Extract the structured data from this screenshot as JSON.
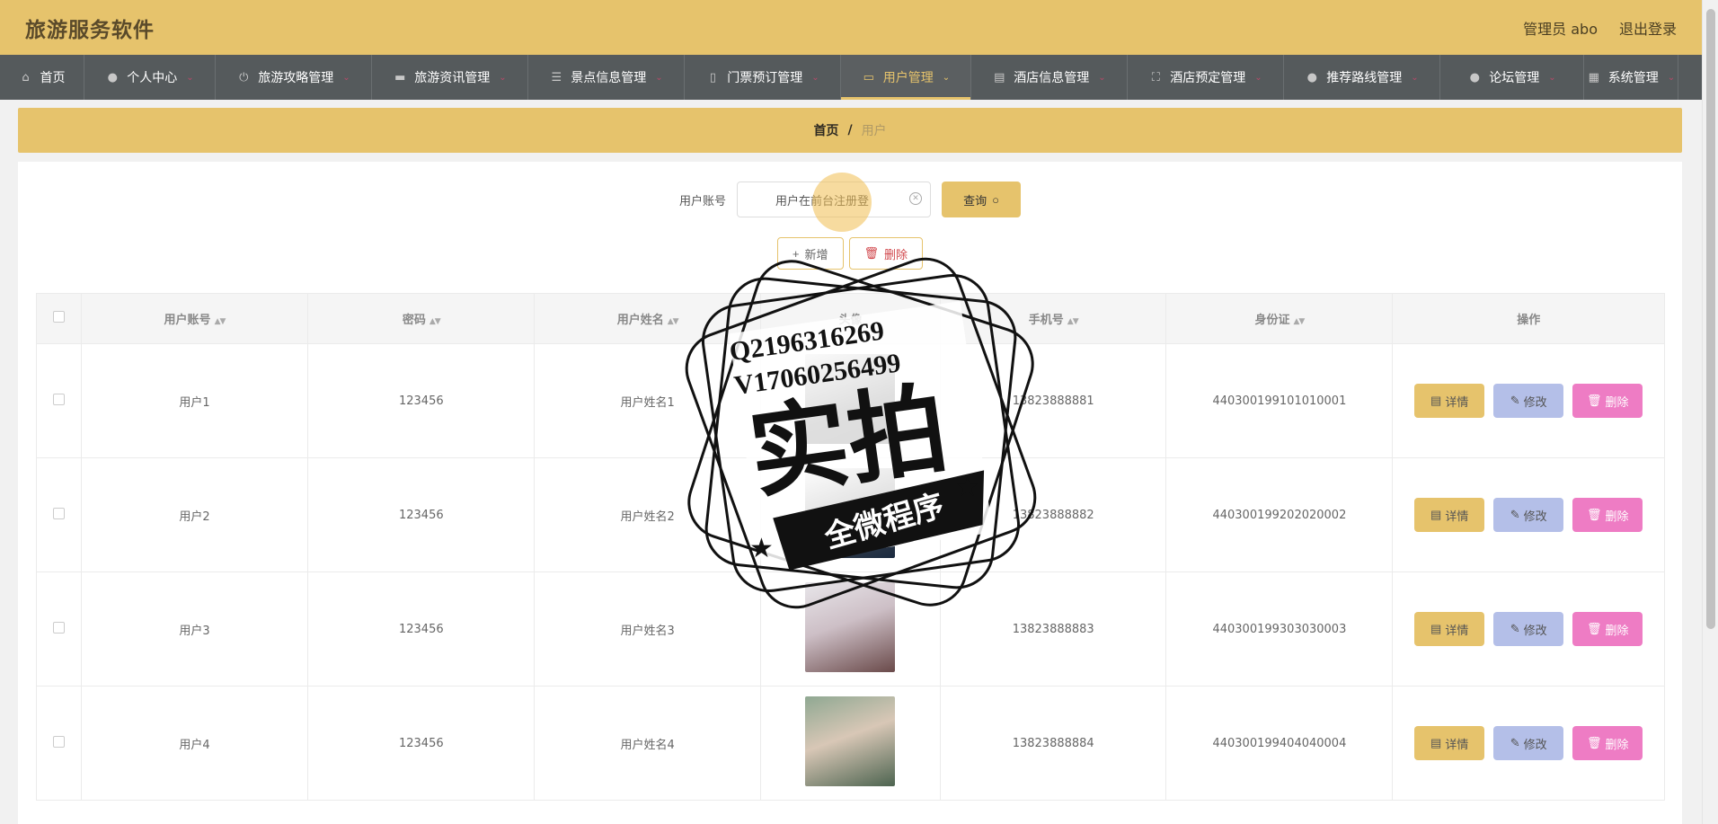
{
  "header": {
    "title": "旅游服务软件",
    "user_label": "管理员 abo",
    "logout_label": "退出登录"
  },
  "nav": {
    "items": [
      {
        "label": "首页",
        "icon": "home-icon",
        "caret": false
      },
      {
        "label": "个人中心",
        "icon": "user-icon",
        "caret": true
      },
      {
        "label": "旅游攻略管理",
        "icon": "power-icon",
        "caret": true
      },
      {
        "label": "旅游资讯管理",
        "icon": "monitor-icon",
        "caret": true
      },
      {
        "label": "景点信息管理",
        "icon": "list-icon",
        "caret": true
      },
      {
        "label": "门票预订管理",
        "icon": "phone-icon",
        "caret": true
      },
      {
        "label": "用户管理",
        "icon": "chat-icon",
        "caret": true,
        "active": true
      },
      {
        "label": "酒店信息管理",
        "icon": "briefcase-icon",
        "caret": true
      },
      {
        "label": "酒店预定管理",
        "icon": "fullscreen-icon",
        "caret": true
      },
      {
        "label": "推荐路线管理",
        "icon": "person-icon",
        "caret": true
      },
      {
        "label": "论坛管理",
        "icon": "person-icon",
        "caret": true
      },
      {
        "label": "系统管理",
        "icon": "grid-icon",
        "caret": true
      }
    ]
  },
  "breadcrumb": {
    "home": "首页",
    "separator": "/",
    "current": "用户"
  },
  "search": {
    "label": "用户账号",
    "value": "用户在前台注册登",
    "query_button": "查询"
  },
  "actions": {
    "add": "新增",
    "delete": "删除"
  },
  "table": {
    "columns": [
      "用户账号",
      "密码",
      "用户姓名",
      "头像",
      "手机号",
      "身份证",
      "操作"
    ],
    "rows": [
      {
        "account": "用户1",
        "password": "123456",
        "name": "用户姓名1",
        "phone": "13823888881",
        "id_card": "440300199101010001"
      },
      {
        "account": "用户2",
        "password": "123456",
        "name": "用户姓名2",
        "phone": "13823888882",
        "id_card": "440300199202020002"
      },
      {
        "account": "用户3",
        "password": "123456",
        "name": "用户姓名3",
        "phone": "13823888883",
        "id_card": "440300199303030003"
      },
      {
        "account": "用户4",
        "password": "123456",
        "name": "用户姓名4",
        "phone": "13823888884",
        "id_card": "440300199404040004"
      }
    ],
    "row_actions": {
      "detail": "详情",
      "edit": "修改",
      "delete": "删除"
    }
  },
  "watermark": {
    "line1": "Q2196316269",
    "line2": "V17060256499",
    "big_text": "实拍",
    "ribbon_text": "全微程序"
  },
  "colors": {
    "accent": "#e6c36c",
    "nav_bg": "#555a5c",
    "edit_btn": "#b4bfe8",
    "delete_btn": "#ee7cc4"
  }
}
